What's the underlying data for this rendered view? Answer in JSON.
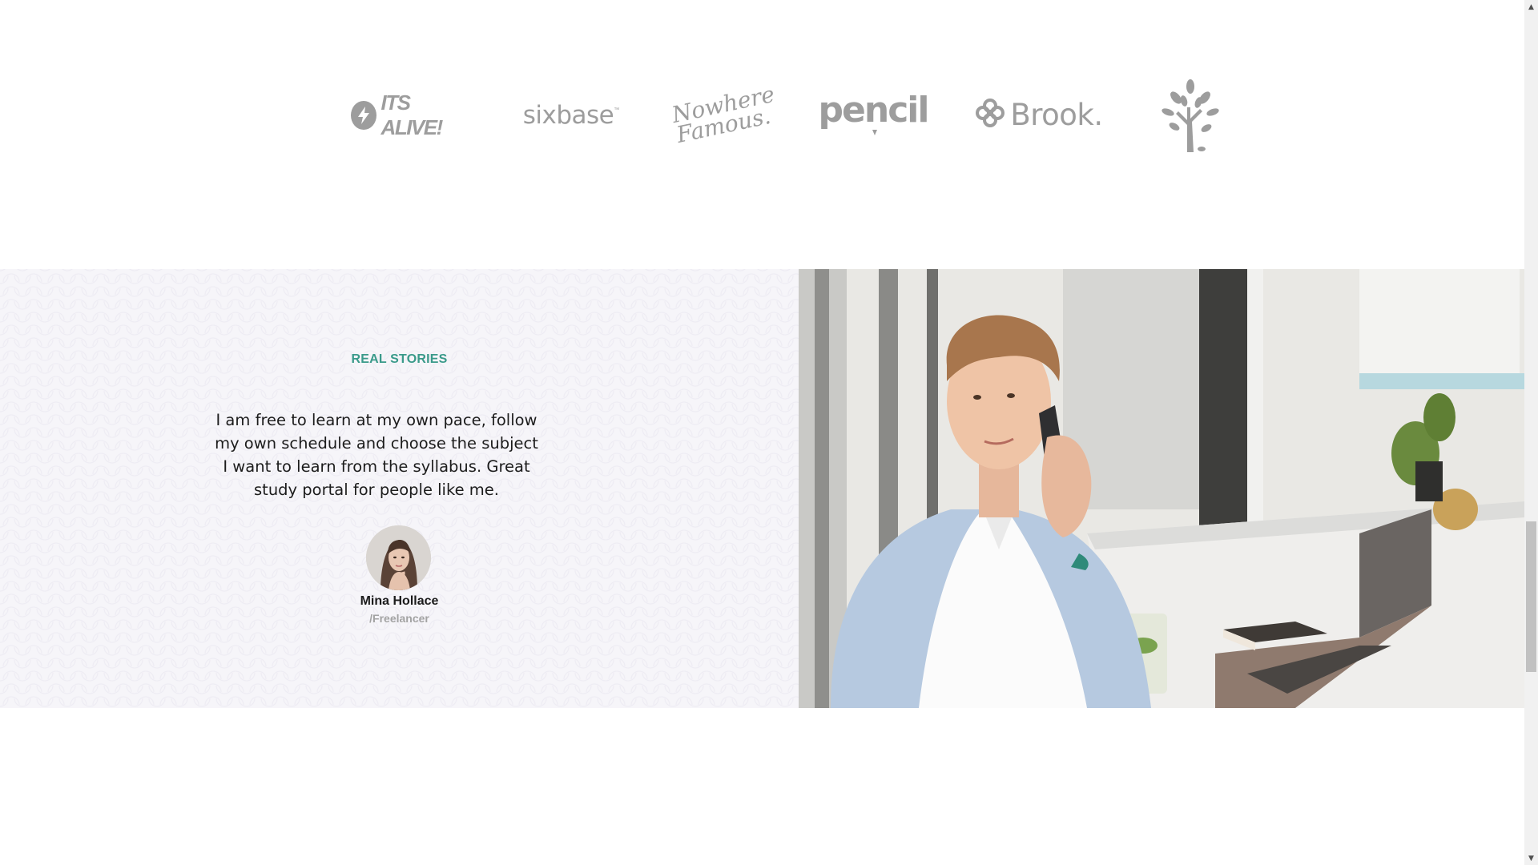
{
  "logos": {
    "its_alive": "ITS ALIVE!",
    "sixbase": "sixbase",
    "sixbase_tm": "™",
    "nowhere_famous_line1": "Nowhere",
    "nowhere_famous_line2": "Famous.",
    "pencil": "pencil",
    "brook": "Brook."
  },
  "testimonial": {
    "eyebrow": "REAL STORIES",
    "quote": "I am free to learn at my own pace, follow my own schedule and choose the subject I want to learn from the syllabus. Great study portal for people like me.",
    "author_name": "Mina Hollace",
    "author_role": "/Freelancer"
  },
  "colors": {
    "accent": "#3a9a8a",
    "logo_gray": "#9d9d9d",
    "section_bg": "#f6f5f9",
    "text": "#1c1c1c"
  },
  "scrollbar": {
    "up_icon": "▲",
    "down_icon": "▼"
  }
}
